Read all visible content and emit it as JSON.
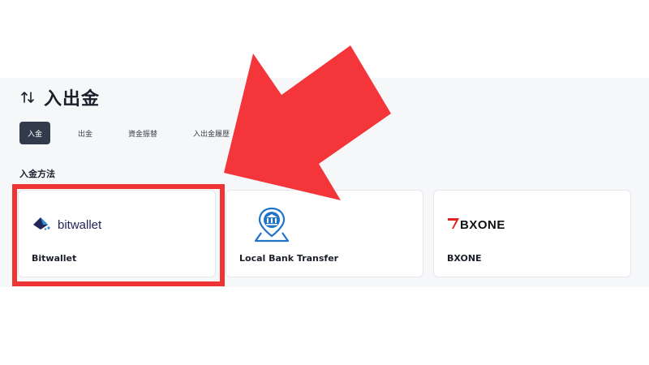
{
  "header": {
    "title": "入出金",
    "icon": "swap-vertical-icon"
  },
  "tabs": [
    {
      "label": "入金",
      "active": true
    },
    {
      "label": "出金",
      "active": false
    },
    {
      "label": "資金振替",
      "active": false
    },
    {
      "label": "入出金履歴",
      "active": false
    }
  ],
  "section": {
    "label": "入金方法"
  },
  "methods": [
    {
      "name": "Bitwallet",
      "logo_text": "bitwallet",
      "icon": "bitwallet-logo-icon"
    },
    {
      "name": "Local Bank Transfer",
      "icon": "bank-location-icon"
    },
    {
      "name": "BXONE",
      "logo_text": "BXONE",
      "icon": "bxone-logo-icon"
    }
  ],
  "colors": {
    "accent": "#323a4b",
    "highlight": "#ee3434",
    "bank_blue": "#1f74c9",
    "bitwallet_navy": "#23265a"
  }
}
